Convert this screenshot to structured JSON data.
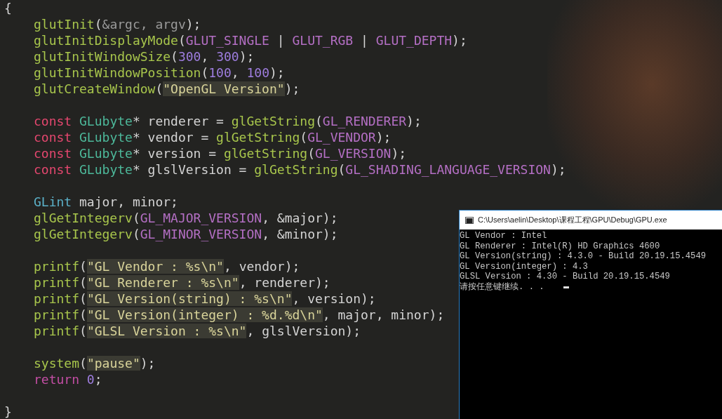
{
  "editor": {
    "open_brace": "{",
    "close_brace": "}",
    "blocks": [
      [
        [
          {
            "text": "glutInit",
            "kind": "fn"
          },
          {
            "text": "(",
            "kind": "p"
          },
          {
            "text": "&argc, argv",
            "kind": "arg"
          },
          {
            "text": ");",
            "kind": "p"
          }
        ],
        [
          {
            "text": "glutInitDisplayMode",
            "kind": "fn"
          },
          {
            "text": "(",
            "kind": "p"
          },
          {
            "text": "GLUT_SINGLE",
            "kind": "macro"
          },
          {
            "text": " | ",
            "kind": "p"
          },
          {
            "text": "GLUT_RGB",
            "kind": "macro"
          },
          {
            "text": " | ",
            "kind": "p"
          },
          {
            "text": "GLUT_DEPTH",
            "kind": "macro"
          },
          {
            "text": ");",
            "kind": "p"
          }
        ],
        [
          {
            "text": "glutInitWindowSize",
            "kind": "fn"
          },
          {
            "text": "(",
            "kind": "p"
          },
          {
            "text": "300",
            "kind": "num"
          },
          {
            "text": ", ",
            "kind": "p"
          },
          {
            "text": "300",
            "kind": "num"
          },
          {
            "text": ");",
            "kind": "p"
          }
        ],
        [
          {
            "text": "glutInitWindowPosition",
            "kind": "fn"
          },
          {
            "text": "(",
            "kind": "p"
          },
          {
            "text": "100",
            "kind": "num"
          },
          {
            "text": ", ",
            "kind": "p"
          },
          {
            "text": "100",
            "kind": "num"
          },
          {
            "text": ");",
            "kind": "p"
          }
        ],
        [
          {
            "text": "glutCreateWindow",
            "kind": "fn"
          },
          {
            "text": "(",
            "kind": "p"
          },
          {
            "text": "\"OpenGL Version\"",
            "kind": "str"
          },
          {
            "text": ");",
            "kind": "p"
          }
        ]
      ],
      [
        [
          {
            "text": "const ",
            "kind": "kw"
          },
          {
            "text": "GLubyte",
            "kind": "type"
          },
          {
            "text": "* renderer = ",
            "kind": "p"
          },
          {
            "text": "glGetString",
            "kind": "fn"
          },
          {
            "text": "(",
            "kind": "p"
          },
          {
            "text": "GL_RENDERER",
            "kind": "macro"
          },
          {
            "text": ");",
            "kind": "p"
          }
        ],
        [
          {
            "text": "const ",
            "kind": "kw"
          },
          {
            "text": "GLubyte",
            "kind": "type"
          },
          {
            "text": "* vendor = ",
            "kind": "p"
          },
          {
            "text": "glGetString",
            "kind": "fn"
          },
          {
            "text": "(",
            "kind": "p"
          },
          {
            "text": "GL_VENDOR",
            "kind": "macro"
          },
          {
            "text": ");",
            "kind": "p"
          }
        ],
        [
          {
            "text": "const ",
            "kind": "kw"
          },
          {
            "text": "GLubyte",
            "kind": "type"
          },
          {
            "text": "* version = ",
            "kind": "p"
          },
          {
            "text": "glGetString",
            "kind": "fn"
          },
          {
            "text": "(",
            "kind": "p"
          },
          {
            "text": "GL_VERSION",
            "kind": "macro"
          },
          {
            "text": ");",
            "kind": "p"
          }
        ],
        [
          {
            "text": "const ",
            "kind": "kw"
          },
          {
            "text": "GLubyte",
            "kind": "type"
          },
          {
            "text": "* glslVersion = ",
            "kind": "p"
          },
          {
            "text": "glGetString",
            "kind": "fn"
          },
          {
            "text": "(",
            "kind": "p"
          },
          {
            "text": "GL_SHADING_LANGUAGE_VERSION",
            "kind": "macro"
          },
          {
            "text": ");",
            "kind": "p"
          }
        ]
      ],
      [
        [
          {
            "text": "GLint",
            "kind": "type2"
          },
          {
            "text": " major, minor;",
            "kind": "p"
          }
        ],
        [
          {
            "text": "glGetIntegerv",
            "kind": "fn"
          },
          {
            "text": "(",
            "kind": "p"
          },
          {
            "text": "GL_MAJOR_VERSION",
            "kind": "macro"
          },
          {
            "text": ", &major);",
            "kind": "p"
          }
        ],
        [
          {
            "text": "glGetIntegerv",
            "kind": "fn"
          },
          {
            "text": "(",
            "kind": "p"
          },
          {
            "text": "GL_MINOR_VERSION",
            "kind": "macro"
          },
          {
            "text": ", &minor);",
            "kind": "p"
          }
        ]
      ],
      [
        [
          {
            "text": "printf",
            "kind": "fn"
          },
          {
            "text": "(",
            "kind": "p"
          },
          {
            "text": "\"GL Vendor : %s\\n\"",
            "kind": "str"
          },
          {
            "text": ", vendor);",
            "kind": "p"
          }
        ],
        [
          {
            "text": "printf",
            "kind": "fn"
          },
          {
            "text": "(",
            "kind": "p"
          },
          {
            "text": "\"GL Renderer : %s\\n\"",
            "kind": "str"
          },
          {
            "text": ", renderer);",
            "kind": "p"
          }
        ],
        [
          {
            "text": "printf",
            "kind": "fn"
          },
          {
            "text": "(",
            "kind": "p"
          },
          {
            "text": "\"GL Version(string) : %s\\n\"",
            "kind": "str"
          },
          {
            "text": ", version);",
            "kind": "p"
          }
        ],
        [
          {
            "text": "printf",
            "kind": "fn"
          },
          {
            "text": "(",
            "kind": "p"
          },
          {
            "text": "\"GL Version(integer) : %d.%d\\n\"",
            "kind": "str"
          },
          {
            "text": ", major, minor);",
            "kind": "p"
          }
        ],
        [
          {
            "text": "printf",
            "kind": "fn"
          },
          {
            "text": "(",
            "kind": "p"
          },
          {
            "text": "\"GLSL Version : %s\\n\"",
            "kind": "str"
          },
          {
            "text": ", glslVersion);",
            "kind": "p"
          }
        ]
      ],
      [
        [
          {
            "text": "system",
            "kind": "fn"
          },
          {
            "text": "(",
            "kind": "p"
          },
          {
            "text": "\"pause\"",
            "kind": "str"
          },
          {
            "text": ");",
            "kind": "p"
          }
        ],
        [
          {
            "text": "return ",
            "kind": "ret"
          },
          {
            "text": "0",
            "kind": "num"
          },
          {
            "text": ";",
            "kind": "p"
          }
        ]
      ]
    ]
  },
  "console": {
    "title": "C:\\Users\\aelin\\Desktop\\课程工程\\GPU\\Debug\\GPU.exe",
    "lines": [
      "GL Vendor : Intel",
      "GL Renderer : Intel(R) HD Graphics 4600",
      "GL Version(string) : 4.3.0 - Build 20.19.15.4549",
      "GL Version(integer) : 4.3",
      "GLSL Version : 4.30 - Build 20.19.15.4549",
      "请按任意键继续. . ."
    ]
  }
}
